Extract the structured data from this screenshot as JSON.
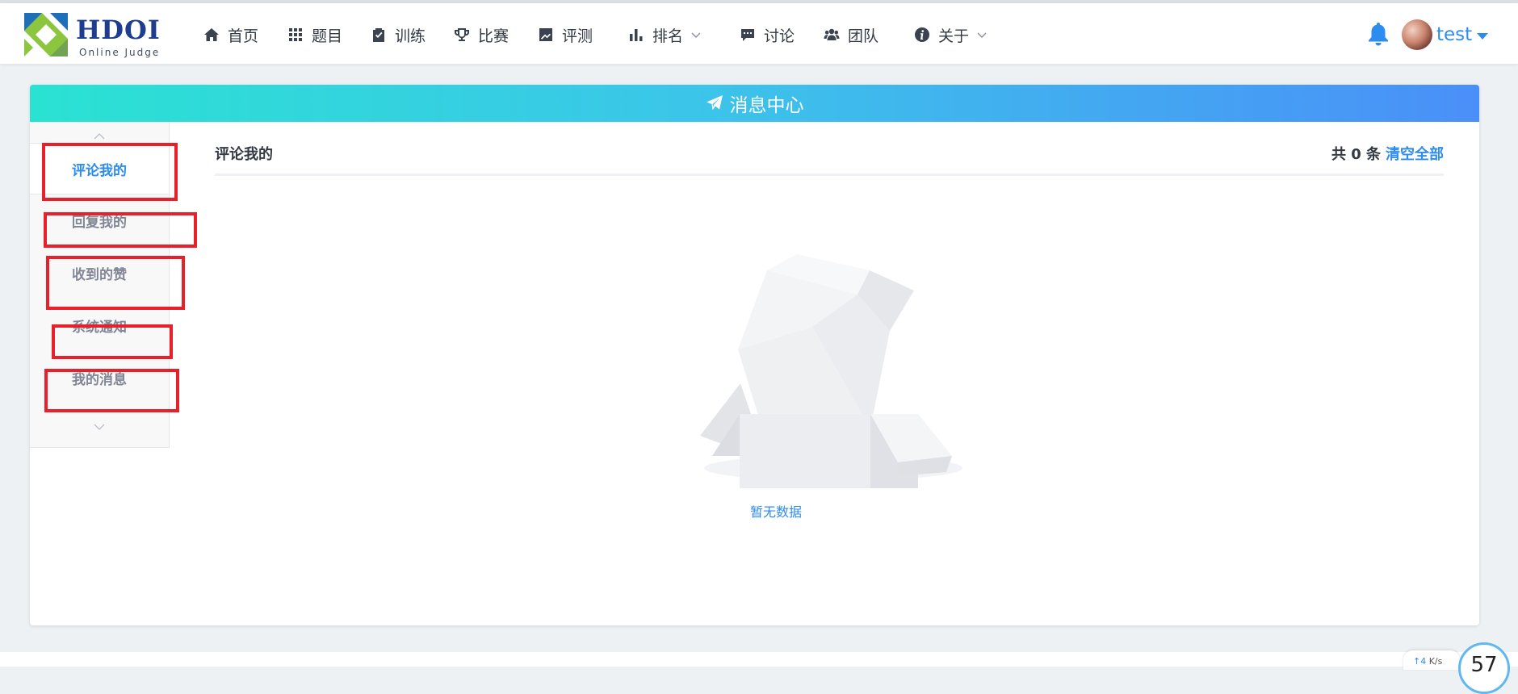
{
  "brand": {
    "name": "HDOI",
    "subtitle": "Online Judge"
  },
  "nav": {
    "items": [
      {
        "label": "首页",
        "icon": "home-icon"
      },
      {
        "label": "题目",
        "icon": "grid-icon"
      },
      {
        "label": "训练",
        "icon": "clipboard-check-icon"
      },
      {
        "label": "比赛",
        "icon": "trophy-icon"
      },
      {
        "label": "评测",
        "icon": "trend-chart-icon"
      },
      {
        "label": "排名",
        "icon": "bar-chart-icon",
        "dropdown": true
      },
      {
        "label": "讨论",
        "icon": "comment-icon"
      },
      {
        "label": "团队",
        "icon": "users-icon"
      },
      {
        "label": "关于",
        "icon": "info-icon",
        "dropdown": true
      }
    ]
  },
  "user": {
    "name": "test"
  },
  "message_center": {
    "title": "消息中心",
    "sidebar": {
      "items": [
        {
          "label": "评论我的",
          "active": true
        },
        {
          "label": "回复我的"
        },
        {
          "label": "收到的赞"
        },
        {
          "label": "系统通知"
        },
        {
          "label": "我的消息"
        }
      ]
    },
    "section_title": "评论我的",
    "count_text": "共 0 条",
    "clear_label": "清空全部",
    "empty_text": "暂无数据"
  },
  "net_speed": {
    "up": "↑4",
    "unit": "K/s"
  },
  "ring_value": "57",
  "colors": {
    "accent": "#2d8cf0",
    "highlight_box": "#e8202a",
    "header_gradient_start": "#2ae2d2",
    "header_gradient_end": "#4a8ff8"
  }
}
